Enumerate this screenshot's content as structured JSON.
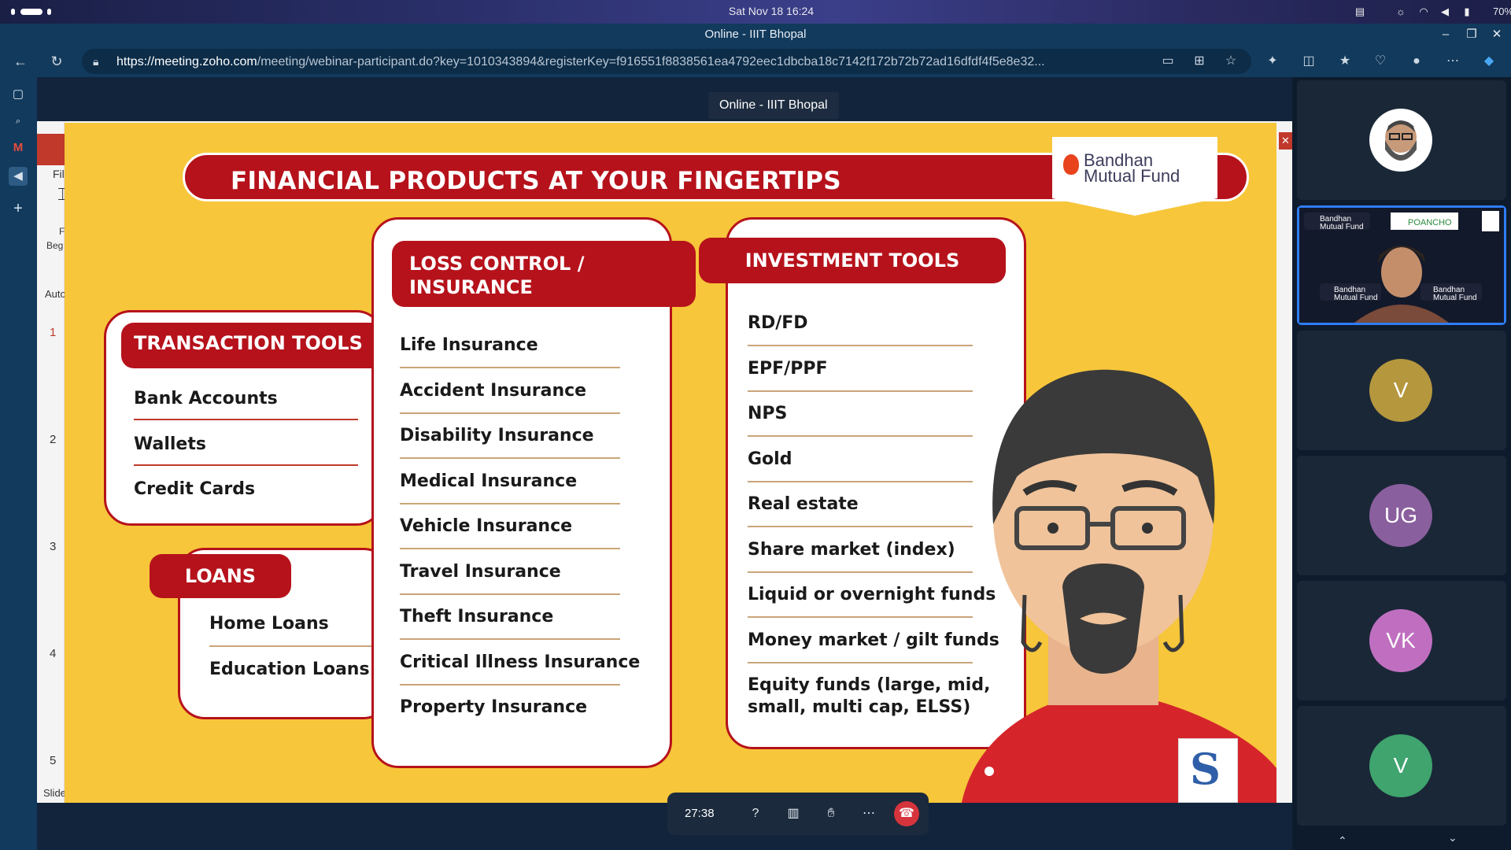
{
  "os": {
    "clock": "Sat Nov 18  16:24",
    "battery": "70%"
  },
  "browser": {
    "window_title": "Online - IIIT Bhopal",
    "url_host": "https://meeting.zoho.com",
    "url_path": "/meeting/webinar-participant.do?key=1010343894&registerKey=f916551f8838561ea4792eec1dbcba18c7142f172b72b72ad16dfdf4f5e8e32..."
  },
  "meeting": {
    "tag": "Online - IIIT Bhopal",
    "timer": "27:38",
    "participants": [
      {
        "initials": "",
        "type": "photo"
      },
      {
        "initials": "",
        "type": "camera"
      },
      {
        "initials": "V",
        "color": "#b5973e"
      },
      {
        "initials": "UG",
        "color": "#8a5f9e"
      },
      {
        "initials": "VK",
        "color": "#c06fc0"
      },
      {
        "initials": "V",
        "color": "#3fa46e"
      }
    ],
    "camera_labels": {
      "brand1": "Bandhan Mutual Fund",
      "brand2": "POANCHO",
      "brand3": "Bandhan Mutual Fund",
      "brand4": "Bandhan Mutual Fund"
    }
  },
  "ppt": {
    "tab_file": "Fil",
    "label_beg": "Beg",
    "label_f": "F",
    "label_auto": "Auto",
    "slides": [
      "1",
      "2",
      "3",
      "4",
      "5"
    ],
    "slide_label": "Slide"
  },
  "slide": {
    "title": "FINANCIAL PRODUCTS AT YOUR FINGERTIPS",
    "logo_line1": "Bandhan",
    "logo_line2": "Mutual Fund",
    "transaction": {
      "heading": "TRANSACTION TOOLS",
      "items": [
        "Bank Accounts",
        "Wallets",
        "Credit Cards"
      ]
    },
    "loans": {
      "heading": "LOANS",
      "items": [
        "Home Loans",
        "Education Loans"
      ]
    },
    "insurance": {
      "heading_line1": "LOSS CONTROL /",
      "heading_line2": "INSURANCE",
      "items": [
        "Life Insurance",
        "Accident Insurance",
        "Disability Insurance",
        "Medical Insurance",
        "Vehicle Insurance",
        "Travel Insurance",
        "Theft Insurance",
        "Critical Illness Insurance",
        "Property Insurance"
      ]
    },
    "investment": {
      "heading": "INVESTMENT TOOLS",
      "items": [
        "RD/FD",
        "EPF/PPF",
        "NPS",
        "Gold",
        "Real estate",
        "Share market (index)",
        "Liquid or overnight funds",
        "Money market / gilt funds",
        "Equity funds (large, mid,",
        "small, multi cap, ELSS)"
      ]
    },
    "colors": {
      "background": "#f7c63a",
      "accent": "#b6121b"
    }
  }
}
